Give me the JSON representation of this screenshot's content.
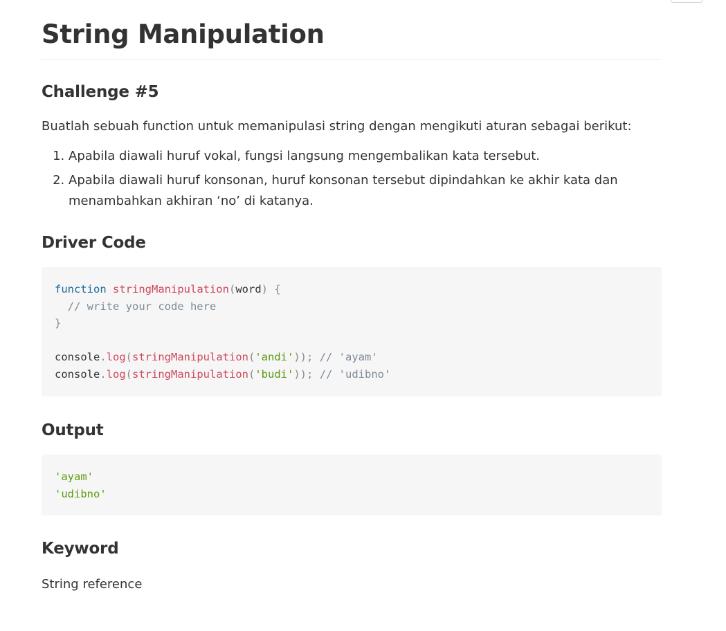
{
  "title": "String Manipulation",
  "challenge": {
    "heading": "Challenge #5",
    "intro": "Buatlah sebuah function untuk memanipulasi string dengan mengikuti aturan sebagai berikut:",
    "rules": [
      "Apabila diawali huruf vokal, fungsi langsung mengembalikan kata tersebut.",
      "Apabila diawali huruf konsonan, huruf konsonan tersebut dipindahkan ke akhir kata dan menambahkan akhiran ‘no’ di katanya."
    ]
  },
  "driver_code": {
    "heading": "Driver Code",
    "lines": [
      "function stringManipulation(word) {",
      "  // write your code here",
      "}",
      "",
      "console.log(stringManipulation('andi')); // 'ayam'",
      "console.log(stringManipulation('budi')); // 'udibno'"
    ]
  },
  "output": {
    "heading": "Output",
    "lines": [
      "'ayam'",
      "'udibno'"
    ]
  },
  "keyword": {
    "heading": "Keyword",
    "text": "String reference"
  },
  "colors": {
    "keyword": "#1c6b9e",
    "function": "#d0465c",
    "string": "#5a9a0f",
    "comment": "#7d8b99",
    "code_background": "#f6f6f6",
    "text": "#333333"
  }
}
